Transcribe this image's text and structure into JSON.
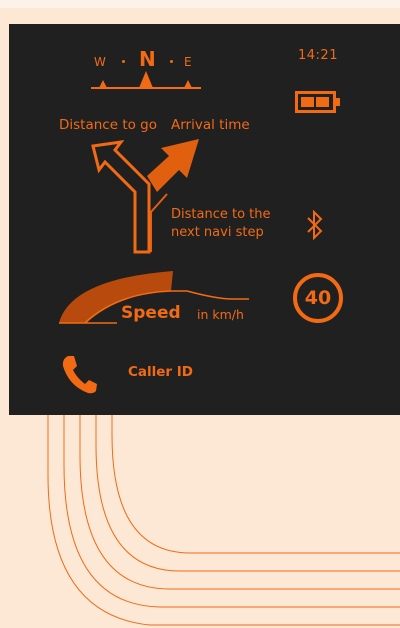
{
  "compass": {
    "west": "W",
    "north": "N",
    "east": "E"
  },
  "status": {
    "time": "14:21",
    "battery_level": 0.66
  },
  "navigation": {
    "distance_label": "Distance to go",
    "arrival_label": "Arrival time",
    "next_step_label": "Distance to the next navi step"
  },
  "speed": {
    "label": "Speed",
    "unit": "in km/h",
    "limit": "40"
  },
  "caller": {
    "label": "Caller ID"
  },
  "icons": {
    "compass": "compass-needle-icon",
    "battery": "battery-icon",
    "turn": "turn-right-arrow-icon",
    "bluetooth": "bluetooth-icon",
    "phone": "phone-icon"
  },
  "colors": {
    "accent": "#f26a14",
    "accent_dark": "#b84a0e",
    "screen": "#202020",
    "background": "#fde8d6"
  }
}
